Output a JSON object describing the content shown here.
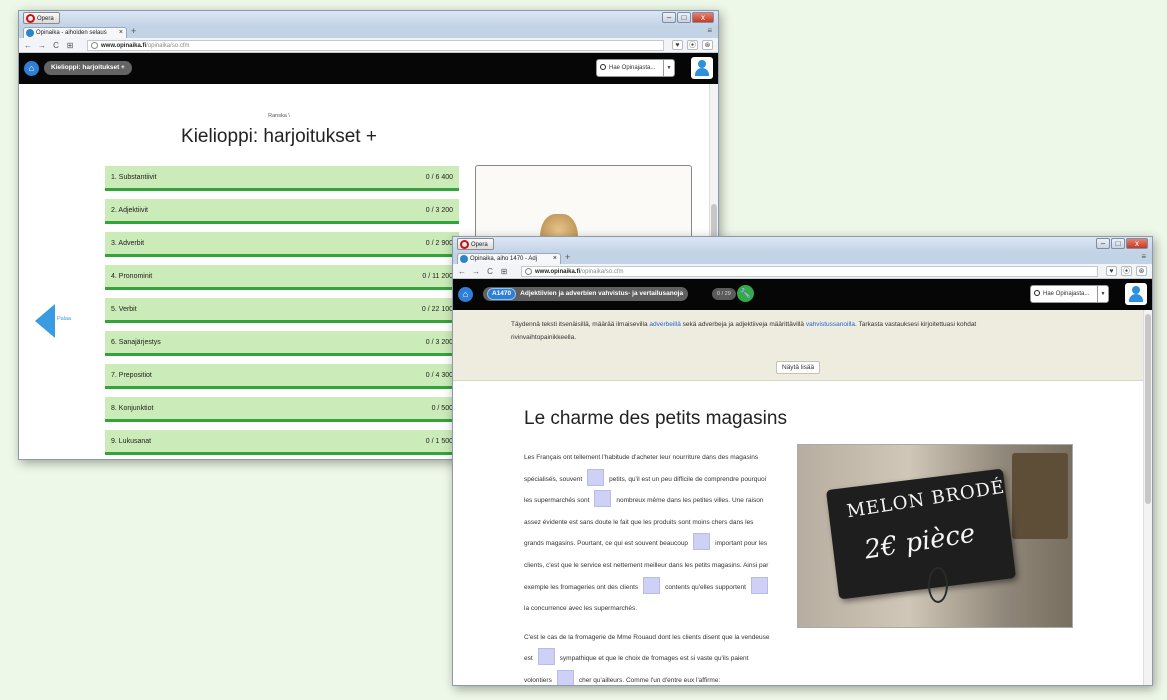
{
  "browser": {
    "opera_label": "Opera",
    "new_tab_symbol": "+",
    "tab_menu_symbol": "≡",
    "nav": {
      "back": "←",
      "forward": "→",
      "reload": "C",
      "grid": "⊞"
    },
    "url_host": "www.opinaika.fi",
    "url_path": "/opinaika/so.cfm",
    "window_controls": {
      "min": "–",
      "max": "□",
      "close": "x"
    },
    "right_icons": {
      "heart": "♥",
      "download": "⦿",
      "person": "⊛"
    }
  },
  "window1": {
    "tab_title": "Opinaika - aihoiden selaus",
    "breadcrumb_label": "Kielioppi: harjoitukset +",
    "search_placeholder": "Hae Opinajasta...",
    "sub_breadcrumb": "Ranska \\",
    "page_title": "Kielioppi: harjoitukset +",
    "back_label": "Palaa",
    "topics": [
      {
        "name": "1. Substantiivit",
        "progress": "0 / 6 400"
      },
      {
        "name": "2. Adjektiivit",
        "progress": "0 / 3 200"
      },
      {
        "name": "3. Adverbit",
        "progress": "0 / 2 900"
      },
      {
        "name": "4. Pronominit",
        "progress": "0 / 11 200"
      },
      {
        "name": "5. Verbit",
        "progress": "0 / 22 100"
      },
      {
        "name": "6. Sanajärjestys",
        "progress": "0 / 3 200"
      },
      {
        "name": "7. Prepositiot",
        "progress": "0 / 4 300"
      },
      {
        "name": "8. Konjunktiot",
        "progress": "0 / 500"
      },
      {
        "name": "9. Lukusanat",
        "progress": "0 / 1 500"
      }
    ]
  },
  "window2": {
    "tab_title": "Opinaika, aiho 1470 - Adj",
    "exercise_code": "A1470",
    "exercise_title": "Adjektiivien ja adverbien vahvistus- ja vertailusanoja",
    "counter": "0 / 29",
    "search_placeholder": "Hae Opinajasta...",
    "instructions": {
      "part1": "Täydennä teksti itsenäisillä, määrää ilmaisevilla ",
      "link1": "adverbeillä",
      "part2": " sekä adverbeja ja adjektiiveja määrittävillä ",
      "link2": "vahvistussanoilla",
      "part3": ". Tarkasta vastauksesi kirjoitettuasi kohdat rivinvaihtopainikkeella."
    },
    "show_more": "Näytä lisää",
    "article_title": "Le charme des petits magasins",
    "para1": {
      "s1": "Les Français ont tellement l'habitude d'acheter leur nourriture dans des magasins spécialisés, souvent",
      "s2": "petits, qu'il est un peu difficile de comprendre pourquoi les supermarchés sont",
      "s3": "nombreux même dans les petites villes. Une raison assez évidente est sans doute le fait que les produits sont moins chers dans les grands magasins. Pourtant, ce qui est souvent beaucoup",
      "s4": "important pour les clients, c'est que le service est nettement meilleur dans les petits magasins. Ainsi par exemple les fromageries ont des clients",
      "s5": "contents qu'elles supportent",
      "s6": "la concurrence avec les supermarchés."
    },
    "para2": {
      "s1": "C'est le cas de la fromagerie de Mme Rouaud dont les clients disent que la vendeuse est",
      "s2": "sympathique et que le choix de fromages est si vaste qu'ils paient volontiers",
      "s3": "cher qu'ailleurs. Comme l'un d'entre eux l'affirme:"
    },
    "photo_chalk_line1": "MELON BRODÉ",
    "photo_chalk_line2": "2€ pièce"
  },
  "colors": {
    "topic_bg": "#cbebb9",
    "topic_underline": "#33a33b",
    "accent_blue": "#2f7fd6",
    "gap_fill": "#cfd0f5",
    "appbar": "#060606"
  }
}
